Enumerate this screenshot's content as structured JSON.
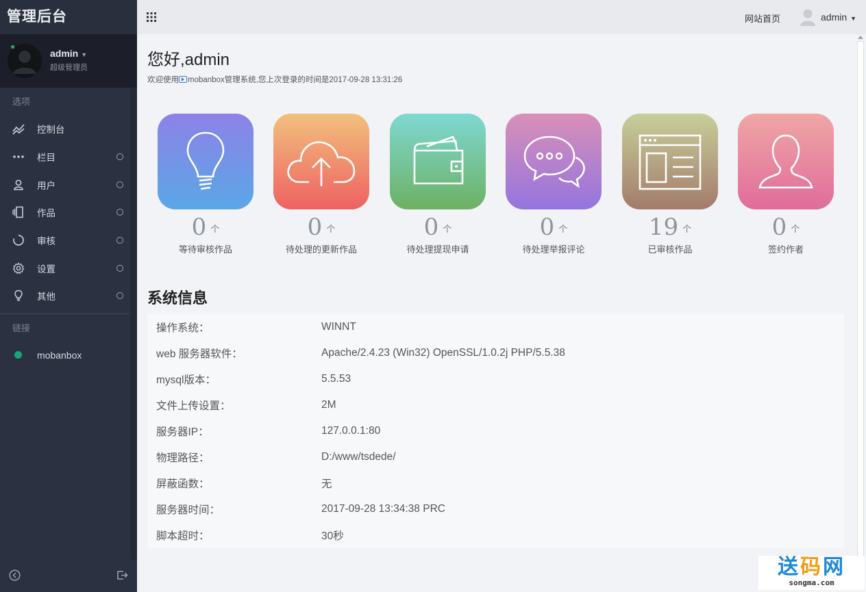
{
  "sidebar": {
    "brand": "管理后台",
    "user": {
      "name": "admin",
      "role": "超级管理员"
    },
    "section_options": "选项",
    "items": [
      {
        "label": "控制台",
        "icon": "chart-line-icon",
        "has_ring": false
      },
      {
        "label": "栏目",
        "icon": "dots-icon",
        "has_ring": true
      },
      {
        "label": "用户",
        "icon": "user-icon",
        "has_ring": true
      },
      {
        "label": "作品",
        "icon": "pages-icon",
        "has_ring": true
      },
      {
        "label": "审核",
        "icon": "spinner-icon",
        "has_ring": true
      },
      {
        "label": "设置",
        "icon": "gear-icon",
        "has_ring": true
      },
      {
        "label": "其他",
        "icon": "bulb-icon",
        "has_ring": true
      }
    ],
    "section_links": "链接",
    "links": [
      {
        "label": "mobanbox"
      }
    ]
  },
  "topbar": {
    "site_home": "网站首页",
    "user": "admin"
  },
  "main": {
    "greeting": "您好,admin",
    "welcome_prefix": "欢迎使用",
    "welcome_suffix": "mobanbox管理系统,您上次登录的时间是2017-09-28 13:31:26",
    "stats": [
      {
        "value": "0",
        "unit": "个",
        "label": "等待审核作品",
        "icon": "bulb-icon",
        "gradient": [
          "#8d82e8",
          "#5aa7e6"
        ]
      },
      {
        "value": "0",
        "unit": "个",
        "label": "待处理的更新作品",
        "icon": "cloud-upload-icon",
        "gradient": [
          "#f2c07d",
          "#ee6262"
        ]
      },
      {
        "value": "0",
        "unit": "个",
        "label": "待处理提现申请",
        "icon": "wallet-icon",
        "gradient": [
          "#7fd8d2",
          "#6db163"
        ]
      },
      {
        "value": "0",
        "unit": "个",
        "label": "待处理举报评论",
        "icon": "chat-icon",
        "gradient": [
          "#d98fb8",
          "#9475df"
        ]
      },
      {
        "value": "19",
        "unit": "个",
        "label": "已审核作品",
        "icon": "browser-icon",
        "gradient": [
          "#c7cf9a",
          "#a37b6b"
        ]
      },
      {
        "value": "0",
        "unit": "个",
        "label": "签约作者",
        "icon": "person-icon",
        "gradient": [
          "#f0a6a6",
          "#e06c9b"
        ]
      }
    ],
    "system_title": "系统信息",
    "system_info": [
      {
        "key": "操作系统：",
        "value": "WINNT"
      },
      {
        "key": "web 服务器软件：",
        "value": "Apache/2.4.23 (Win32) OpenSSL/1.0.2j PHP/5.5.38"
      },
      {
        "key": "mysql版本：",
        "value": "5.5.53"
      },
      {
        "key": "文件上传设置：",
        "value": "2M"
      },
      {
        "key": "服务器IP：",
        "value": "127.0.0.1:80"
      },
      {
        "key": "物理路径：",
        "value": "D:/www/tsdede/"
      },
      {
        "key": "屏蔽函数：",
        "value": "无"
      },
      {
        "key": "服务器时间：",
        "value": "2017-09-28 13:34:38 PRC"
      },
      {
        "key": "脚本超时：",
        "value": "30秒"
      }
    ]
  },
  "watermark": {
    "line1_a": "送",
    "line1_b": "码",
    "line1_c": "网",
    "line2": "songma.com"
  }
}
